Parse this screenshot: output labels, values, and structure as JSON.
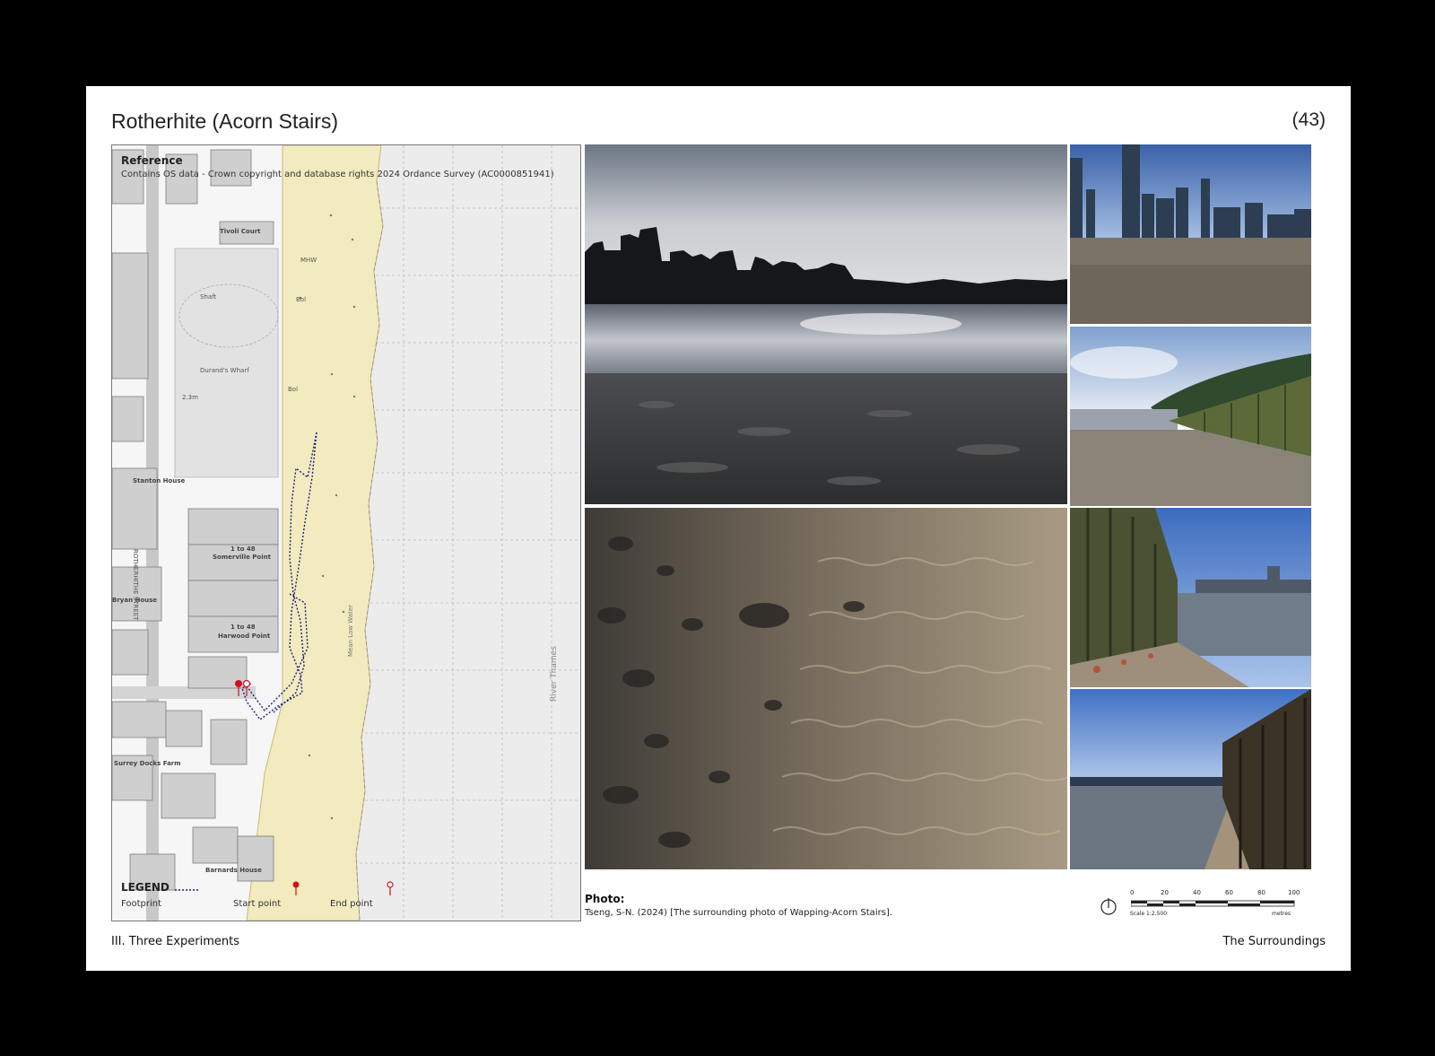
{
  "header": {
    "title": "Rotherhite (Acorn Stairs)",
    "page_number": "(43)"
  },
  "map": {
    "reference_title": "Reference",
    "reference_text": "Contains OS data - Crown copyright and database rights 2024 Ordance Survey (AC0000851941)",
    "legend_title": "LEGEND",
    "legend_footprint": "Footprint",
    "legend_start": "Start point",
    "legend_end": "End point",
    "labels": {
      "tivoli": "Tivoli Court",
      "shaft": "Shaft",
      "durand": "Durand's Wharf",
      "stanton": "Stanton House",
      "sommerville": "Somerville Point",
      "sommerville_range": "1 to 48",
      "harwood": "Harwood Point",
      "harwood_range": "1 to 48",
      "bryan": "Bryan House",
      "surrey": "Surrey Docks Farm",
      "barnards": "Barnards House",
      "street": "ROTHERHITHE STREET",
      "river": "River Thames",
      "mlw": "Mean Low Water",
      "mhw": "MHW",
      "bol1": "Bol",
      "bol2": "Bol",
      "elev": "2.3m"
    },
    "colors": {
      "foreshore": "#f2ebbf",
      "footprint": "#1c1f7a",
      "start": "#d01020",
      "end": "#d01020"
    }
  },
  "caption": {
    "label": "Photo:",
    "text": "Tseng, S-N. (2024) [The surrounding photo of Wapping-Acorn Stairs]."
  },
  "scale": {
    "ticks": [
      "0",
      "20",
      "40",
      "60",
      "80",
      "100"
    ],
    "label": "Scale 1:2,500",
    "unit": "metres",
    "north_icon": "north-arrow-icon"
  },
  "footer": {
    "left": "III. Three Experiments",
    "right": "The Surroundings"
  }
}
